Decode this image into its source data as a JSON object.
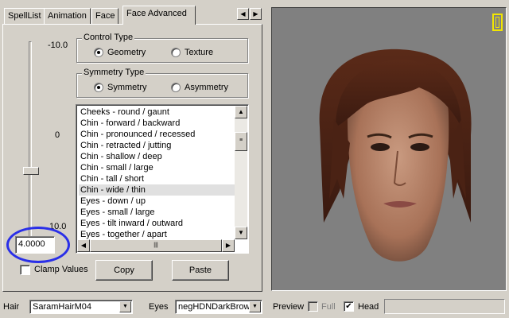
{
  "tabs": [
    "SpellList",
    "Animation",
    "Face",
    "Face Advanced"
  ],
  "active_tab": "Face Advanced",
  "slider": {
    "top_label": "-10.0",
    "mid_label": "0",
    "bottom_label": "10.0",
    "value": "4.0000"
  },
  "control_type": {
    "title": "Control Type",
    "options": [
      "Geometry",
      "Texture"
    ],
    "selected": "Geometry"
  },
  "symmetry_type": {
    "title": "Symmetry Type",
    "options": [
      "Symmetry",
      "Asymmetry"
    ],
    "selected": "Symmetry"
  },
  "morph_list": {
    "items": [
      "Cheeks - round / gaunt",
      "Chin - forward / backward",
      "Chin - pronounced / recessed",
      "Chin - retracted / jutting",
      "Chin - shallow / deep",
      "Chin - small / large",
      "Chin - tall / short",
      "Chin - wide / thin",
      "Eyes - down / up",
      "Eyes - small / large",
      "Eyes - tilt inward / outward",
      "Eyes - together / apart"
    ],
    "selected": "Chin - wide / thin"
  },
  "clamp_values_label": "Clamp Values",
  "copy_label": "Copy",
  "paste_label": "Paste",
  "bottom_bar": {
    "hair_label": "Hair",
    "hair_value": "SaramHairM04",
    "eyes_label": "Eyes",
    "eyes_value": "negHDNDarkBrow",
    "preview_label": "Preview",
    "full_label": "Full",
    "head_label": "Head",
    "head_checked": true
  },
  "colors": {
    "face": "#d4d0c8",
    "viewport_bg": "#808080",
    "highlight_circle": "#2a2fe8",
    "indicator": "#f2e600"
  }
}
